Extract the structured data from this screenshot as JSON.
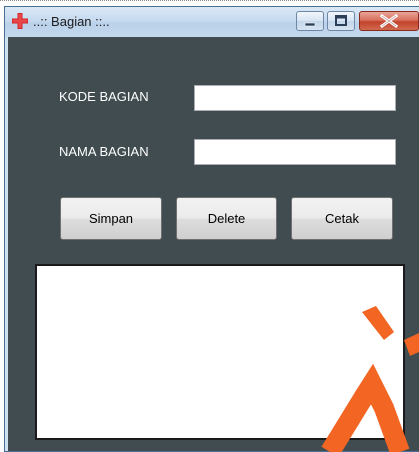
{
  "window": {
    "title": "..:: Bagian ::..",
    "icon": "red-cross-icon"
  },
  "caption_buttons": {
    "minimize_icon": "minimize-icon",
    "maximize_icon": "maximize-icon",
    "close_icon": "close-icon"
  },
  "form": {
    "kode_label": "KODE BAGIAN",
    "kode_value": "",
    "nama_label": "NAMA BAGIAN",
    "nama_value": ""
  },
  "buttons": {
    "simpan": "Simpan",
    "delete": "Delete",
    "cetak": "Cetak"
  },
  "listbox": {
    "items": []
  },
  "colors": {
    "client_background": "#404c50",
    "watermark": "#f26522",
    "titlebar": "#c6daef",
    "close_button": "#c2432c"
  }
}
